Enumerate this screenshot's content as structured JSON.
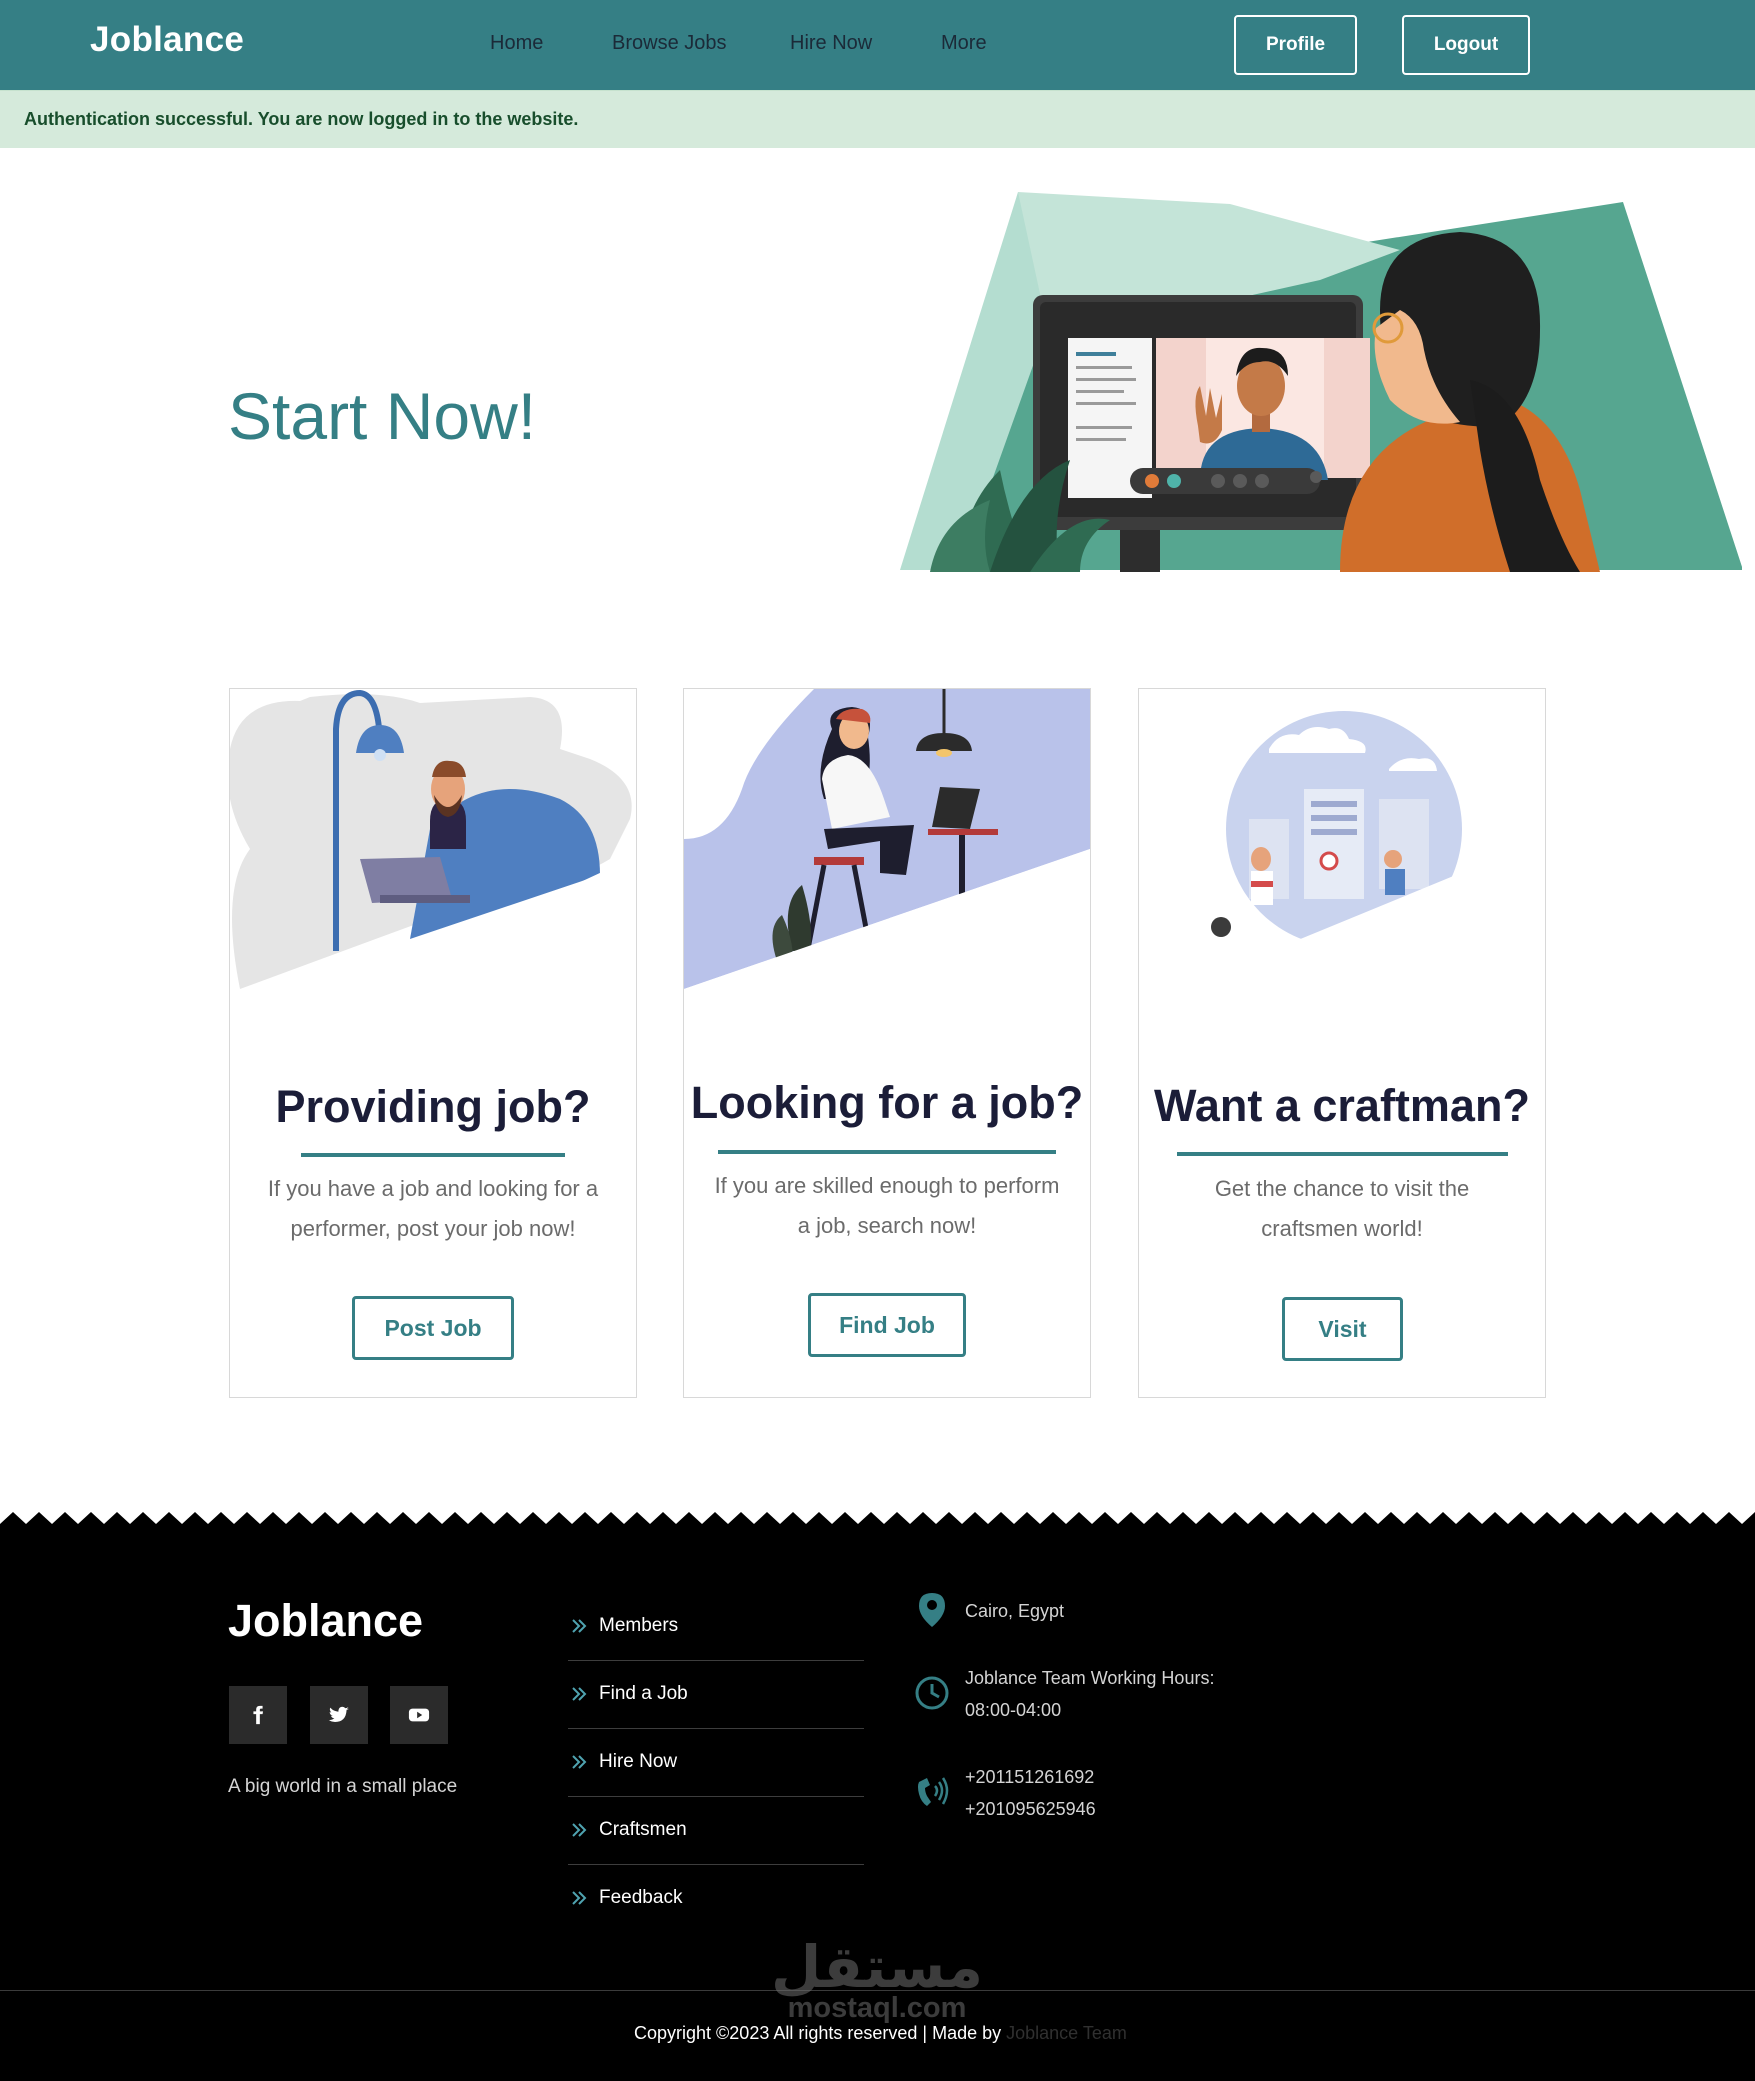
{
  "header": {
    "brand": "Joblance",
    "nav": [
      "Home",
      "Browse Jobs",
      "Hire Now",
      "More"
    ],
    "profile_button": "Profile",
    "logout_button": "Logout"
  },
  "alert": {
    "message": "Authentication successful. You are now logged in to the website."
  },
  "hero": {
    "title": "Start Now!"
  },
  "cards": [
    {
      "title": "Providing job?",
      "text": "If you have a job and looking for a performer, post your job now!",
      "button": "Post Job"
    },
    {
      "title": "Looking for a job?",
      "text": "If you are skilled enough to perform a job, search now!",
      "button": "Find Job"
    },
    {
      "title": "Want a craftman?",
      "text": "Get the chance to visit the craftsmen world!",
      "button": "Visit"
    }
  ],
  "footer": {
    "brand": "Joblance",
    "social": [
      "facebook-icon",
      "twitter-icon",
      "youtube-icon"
    ],
    "tagline": "A big world in a small place",
    "links": [
      "Members",
      "Find a Job",
      "Hire Now",
      "Craftsmen",
      "Feedback"
    ],
    "location": "Cairo, Egypt",
    "hours_label": "Joblance Team Working Hours:",
    "hours": "08:00-04:00",
    "phones": [
      "+201151261692",
      "+201095625946"
    ],
    "copyright": "Copyright ©2023 All rights reserved | Made by",
    "made_by": "Joblance Team"
  },
  "watermark": {
    "arabic": "مستقل",
    "latin": "mostaql.com"
  },
  "colors": {
    "primary": "#357f85",
    "alert_bg": "#d5eadb",
    "alert_text": "#184e2c",
    "heading": "#1b1d38",
    "footer_bg": "#000000"
  }
}
